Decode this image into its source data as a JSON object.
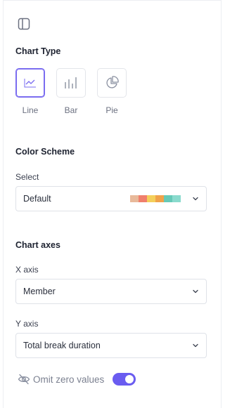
{
  "chart_type": {
    "title": "Chart Type",
    "options": [
      {
        "label": "Line",
        "icon": "line-chart-icon",
        "active": true
      },
      {
        "label": "Bar",
        "icon": "bar-chart-icon",
        "active": false
      },
      {
        "label": "Pie",
        "icon": "pie-chart-icon",
        "active": false
      }
    ]
  },
  "color_scheme": {
    "title": "Color Scheme",
    "select_label": "Select",
    "value": "Default",
    "swatches": [
      "#e8b99a",
      "#f07f6c",
      "#f4cf5a",
      "#f0a24a",
      "#66c9b7",
      "#8adacd"
    ]
  },
  "chart_axes": {
    "title": "Chart axes",
    "x_label": "X axis",
    "x_value": "Member",
    "y_label": "Y axis",
    "y_value": "Total break duration"
  },
  "omit_zero": {
    "label": "Omit zero values",
    "enabled": true
  },
  "colors": {
    "accent": "#6a5cf0",
    "border": "#dfe2e8"
  }
}
